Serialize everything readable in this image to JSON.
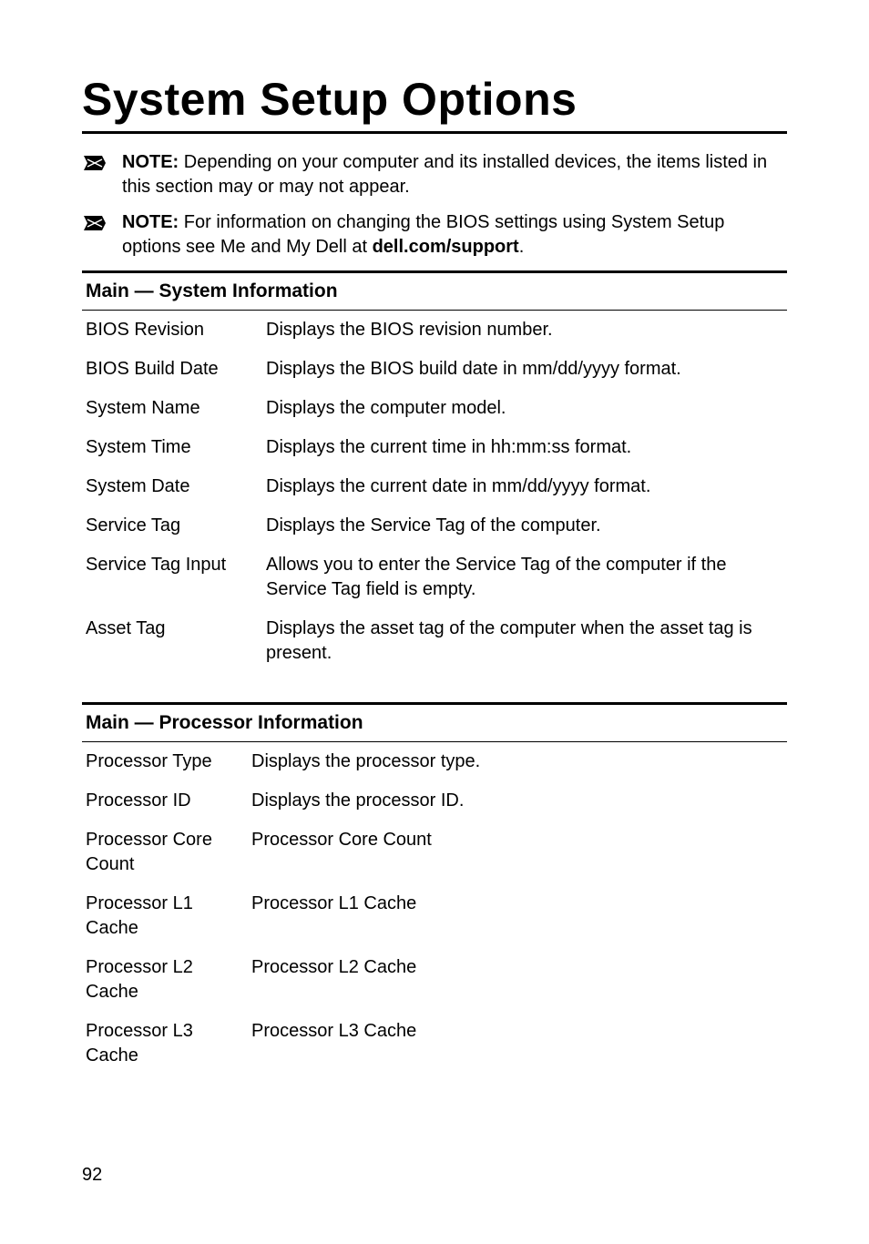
{
  "title": "System Setup Options",
  "notes": [
    {
      "label": "NOTE:",
      "text_before": " Depending on your computer and its installed devices, the items listed in this section may or may not appear.",
      "bold_in_text": null,
      "text_after": null
    },
    {
      "label": "NOTE:",
      "text_before": " For information on changing the BIOS settings using System Setup options see Me and My Dell at ",
      "bold_in_text": "dell.com/support",
      "text_after": "."
    }
  ],
  "sections": [
    {
      "header": "Main — System Information",
      "rows": [
        {
          "key": "BIOS Revision",
          "val": "Displays the BIOS revision number."
        },
        {
          "key": "BIOS Build Date",
          "val": "Displays the BIOS build date in mm/dd/yyyy format."
        },
        {
          "key": "System Name",
          "val": "Displays the computer model."
        },
        {
          "key": "System Time",
          "val": "Displays the current time in hh:mm:ss format."
        },
        {
          "key": "System Date",
          "val": "Displays the current date in mm/dd/yyyy format."
        },
        {
          "key": "Service Tag",
          "val": "Displays the Service Tag of the computer."
        },
        {
          "key": "Service Tag Input",
          "val": "Allows you to enter the Service Tag of the computer if the Service Tag field is empty."
        },
        {
          "key": "Asset Tag",
          "val": "Displays the asset tag of the computer when the asset tag is present."
        }
      ]
    },
    {
      "header": "Main — Processor Information",
      "rows": [
        {
          "key": "Processor Type",
          "val": "Displays the processor type."
        },
        {
          "key": "Processor ID",
          "val": "Displays the processor ID."
        },
        {
          "key": "Processor Core Count",
          "val": "Processor Core Count"
        },
        {
          "key": "Processor L1 Cache",
          "val": "Processor L1 Cache"
        },
        {
          "key": "Processor L2 Cache",
          "val": "Processor L2 Cache"
        },
        {
          "key": "Processor L3 Cache",
          "val": "Processor L3 Cache"
        }
      ]
    }
  ],
  "page_number": "92"
}
